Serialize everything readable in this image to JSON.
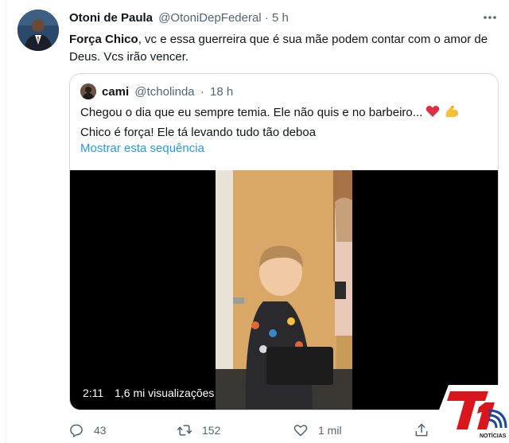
{
  "tweet": {
    "author_name": "Otoni de Paula",
    "author_handle": "@OtoniDepFederal",
    "separator": "·",
    "time": "5 h",
    "text_bold": "Força Chico",
    "text_rest": ", vc e essa guerreira que é sua mãe podem contar com o amor de Deus. Vcs irão vencer."
  },
  "quote": {
    "author_name": "cami",
    "author_handle": "@tcholinda",
    "separator": "·",
    "time": "18 h",
    "line1": "Chegou o dia que eu sempre temia. Ele não quis e no barbeiro...",
    "line2": "Chico é força! Ele tá levando tudo tão deboa",
    "show_thread": "Mostrar esta sequência",
    "video": {
      "duration": "2:11",
      "views": "1,6 mi visualizações"
    }
  },
  "actions": {
    "reply_count": "43",
    "retweet_count": "152",
    "like_count": "1 mil"
  },
  "watermark": {
    "logo_text": "T1",
    "logo_sub": "NOTÍCIAS"
  },
  "colors": {
    "link": "#1d9bf0",
    "secondary_text": "#536471",
    "border": "#cfd9de",
    "logo_red": "#d9161c"
  },
  "icons": {
    "more": "more-icon",
    "reply": "reply-icon",
    "retweet": "retweet-icon",
    "like": "heart-icon",
    "share": "share-icon",
    "red_heart": "red-heart-emoji",
    "flexed_bicep": "flexed-bicep-emoji"
  }
}
